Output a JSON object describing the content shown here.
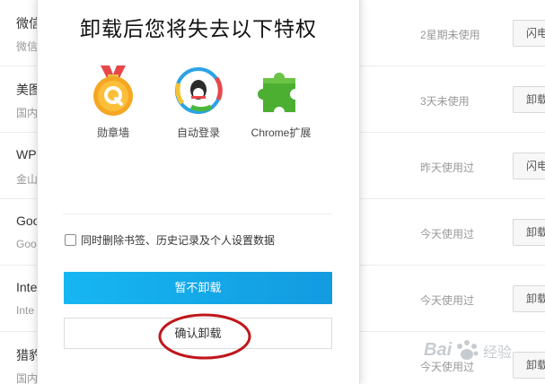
{
  "background_rows": [
    {
      "name": "微信",
      "sub": "微信",
      "status": "2星期未使用",
      "button": "闪电"
    },
    {
      "name": "美图",
      "sub": "国内",
      "status": "3天未使用",
      "button": "卸载"
    },
    {
      "name": "WP",
      "sub": "金山",
      "status": "昨天使用过",
      "button": "闪电"
    },
    {
      "name": "Goo",
      "sub": "Goo",
      "status": "今天使用过",
      "button": "卸载"
    },
    {
      "name": "Inte",
      "sub": "Inte",
      "status": "今天使用过",
      "button": "卸载"
    },
    {
      "name": "猎豹",
      "sub": "国内",
      "status": "今天使用过",
      "button": "卸载"
    }
  ],
  "modal": {
    "title": "卸载后您将失去以下特权",
    "features": [
      {
        "label": "勋章墙",
        "icon": "medal-icon",
        "color": "#f5a623"
      },
      {
        "label": "自动登录",
        "icon": "qq-icon",
        "color": "#2aa3e6"
      },
      {
        "label": "Chrome扩展",
        "icon": "puzzle-icon",
        "color": "#4caf32"
      }
    ],
    "checkbox_label": "同时删除书签、历史记录及个人设置数据",
    "checkbox_checked": false,
    "primary_button": "暂不卸载",
    "secondary_button": "确认卸载"
  },
  "colors": {
    "primary": "#139be0",
    "annotation": "#c0161b"
  }
}
